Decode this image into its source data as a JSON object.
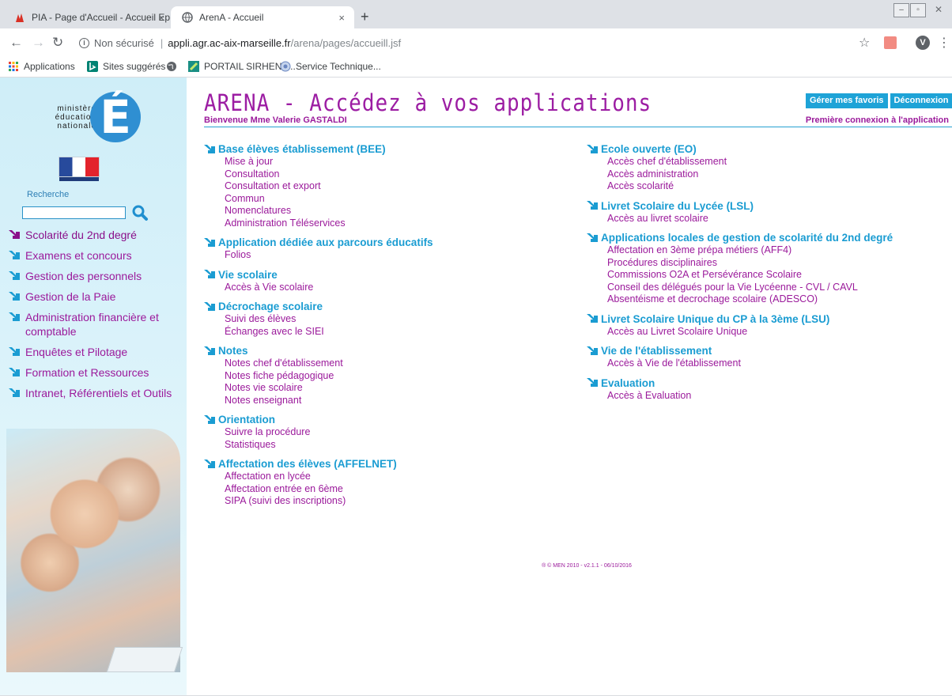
{
  "browser": {
    "tabs": [
      {
        "title": "PIA - Page d'Accueil - Accueil Ep",
        "close": "×"
      },
      {
        "title": "ArenA - Accueil",
        "close": "×"
      }
    ],
    "new_tab": "+",
    "url_security": "Non sécurisé",
    "url_separator": "|",
    "url_host": "appli.agr.ac-aix-marseille.fr",
    "url_path": "/arena/pages/accueill.jsf",
    "avatar_letter": "V",
    "bookmarks": [
      "Applications",
      "Sites suggérés",
      "PORTAIL SIRHEN -...",
      "Service Technique..."
    ]
  },
  "app": {
    "title": "ARENA - Accédez à vos applications",
    "welcome": "Bienvenue Mme Valerie GASTALDI",
    "first_connection": "Première connexion à l'application",
    "buttons": {
      "favorites": "Gérer mes favoris",
      "logout": "Déconnexion"
    },
    "copyright": "® © MEN 2010 - v2.1.1 - 06/10/2016"
  },
  "sidebar": {
    "logo_text": "ministère éducation nationale",
    "search_label": "Recherche",
    "search_value": "",
    "nav": [
      "Scolarité du 2nd degré",
      "Examens et concours",
      "Gestion des personnels",
      "Gestion de la Paie",
      "Administration financière et comptable",
      "Enquêtes et Pilotage",
      "Formation et Ressources",
      "Intranet, Référentiels et Outils"
    ]
  },
  "groups_left": [
    {
      "title": "Base élèves établissement (BEE)",
      "links": [
        "Mise à jour",
        "Consultation",
        "Consultation et export",
        "Commun",
        "Nomenclatures",
        "Administration Téléservices"
      ]
    },
    {
      "title": "Application dédiée aux parcours éducatifs",
      "links": [
        "Folios"
      ]
    },
    {
      "title": "Vie scolaire",
      "links": [
        "Accès à Vie scolaire"
      ]
    },
    {
      "title": "Décrochage scolaire",
      "links": [
        "Suivi des élèves",
        "Échanges avec le SIEI"
      ]
    },
    {
      "title": "Notes",
      "links": [
        "Notes chef d'établissement",
        "Notes fiche pédagogique",
        "Notes vie scolaire",
        "Notes enseignant"
      ]
    },
    {
      "title": "Orientation",
      "links": [
        "Suivre la procédure",
        "Statistiques"
      ]
    },
    {
      "title": "Affectation des élèves (AFFELNET)",
      "links": [
        "Affectation en lycée",
        "Affectation entrée en 6ème",
        "SIPA (suivi des inscriptions)"
      ]
    }
  ],
  "groups_right": [
    {
      "title": "Ecole ouverte (EO)",
      "links": [
        "Accès chef d'établissement",
        "Accès administration",
        "Accès scolarité"
      ]
    },
    {
      "title": "Livret Scolaire du Lycée (LSL)",
      "links": [
        "Accès au livret scolaire"
      ]
    },
    {
      "title": "Applications locales de gestion de scolarité du 2nd degré",
      "links": [
        "Affectation en 3ème prépa métiers (AFF4)",
        "Procédures disciplinaires",
        "Commissions O2A et Persévérance Scolaire",
        "Conseil des délégués pour la Vie Lycéenne - CVL / CAVL",
        "Absentéisme et decrochage scolaire (ADESCO)"
      ]
    },
    {
      "title": "Livret Scolaire Unique du CP à la 3ème (LSU)",
      "links": [
        "Accès au Livret Scolaire Unique"
      ]
    },
    {
      "title": "Vie de l'établissement",
      "links": [
        "Accès à Vie de l'établissement"
      ]
    },
    {
      "title": "Evaluation",
      "links": [
        "Accès à Evaluation"
      ]
    }
  ],
  "colors": {
    "accent_blue": "#1a9cd2",
    "link_purple": "#9b1a9b",
    "button_blue": "#1ea3d7",
    "title_purple": "#9c1da3"
  }
}
